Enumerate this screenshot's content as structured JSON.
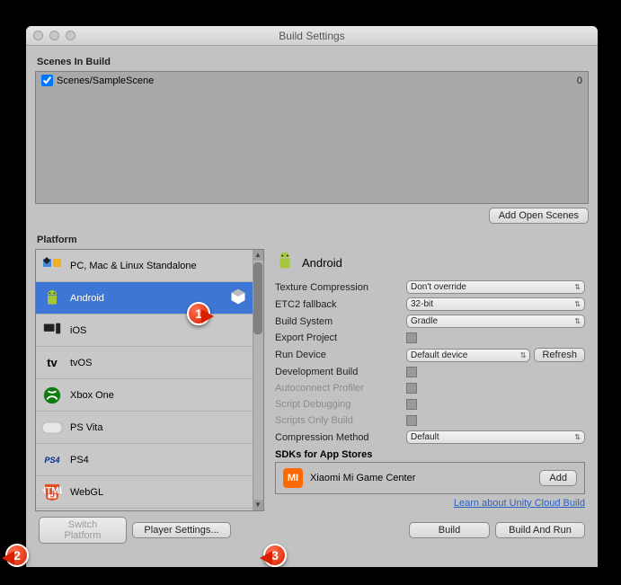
{
  "window": {
    "title": "Build Settings"
  },
  "scenes": {
    "heading": "Scenes In Build",
    "items": [
      {
        "name": "Scenes/SampleScene",
        "index": "0",
        "checked": true
      }
    ],
    "add_button": "Add Open Scenes"
  },
  "platform": {
    "heading": "Platform",
    "items": [
      {
        "id": "standalone",
        "label": "PC, Mac & Linux Standalone"
      },
      {
        "id": "android",
        "label": "Android",
        "selected": true
      },
      {
        "id": "ios",
        "label": "iOS"
      },
      {
        "id": "tvos",
        "label": "tvOS"
      },
      {
        "id": "xboxone",
        "label": "Xbox One"
      },
      {
        "id": "psvita",
        "label": "PS Vita"
      },
      {
        "id": "ps4",
        "label": "PS4"
      },
      {
        "id": "webgl",
        "label": "WebGL"
      }
    ]
  },
  "detail": {
    "title": "Android",
    "rows": {
      "texture_compression": {
        "label": "Texture Compression",
        "value": "Don't override"
      },
      "etc2_fallback": {
        "label": "ETC2 fallback",
        "value": "32-bit"
      },
      "build_system": {
        "label": "Build System",
        "value": "Gradle"
      },
      "export_project": {
        "label": "Export Project"
      },
      "run_device": {
        "label": "Run Device",
        "value": "Default device",
        "refresh": "Refresh"
      },
      "development_build": {
        "label": "Development Build"
      },
      "autoconnect_profiler": {
        "label": "Autoconnect Profiler"
      },
      "script_debugging": {
        "label": "Script Debugging"
      },
      "scripts_only_build": {
        "label": "Scripts Only Build"
      },
      "compression_method": {
        "label": "Compression Method",
        "value": "Default"
      }
    },
    "sdks": {
      "heading": "SDKs for App Stores",
      "item": "Xiaomi Mi Game Center",
      "add": "Add"
    },
    "cloud_link": "Learn about Unity Cloud Build"
  },
  "footer": {
    "switch_platform": "Switch Platform",
    "player_settings": "Player Settings...",
    "build": "Build",
    "build_and_run": "Build And Run"
  },
  "callouts": {
    "c1": "1",
    "c2": "2",
    "c3": "3"
  }
}
